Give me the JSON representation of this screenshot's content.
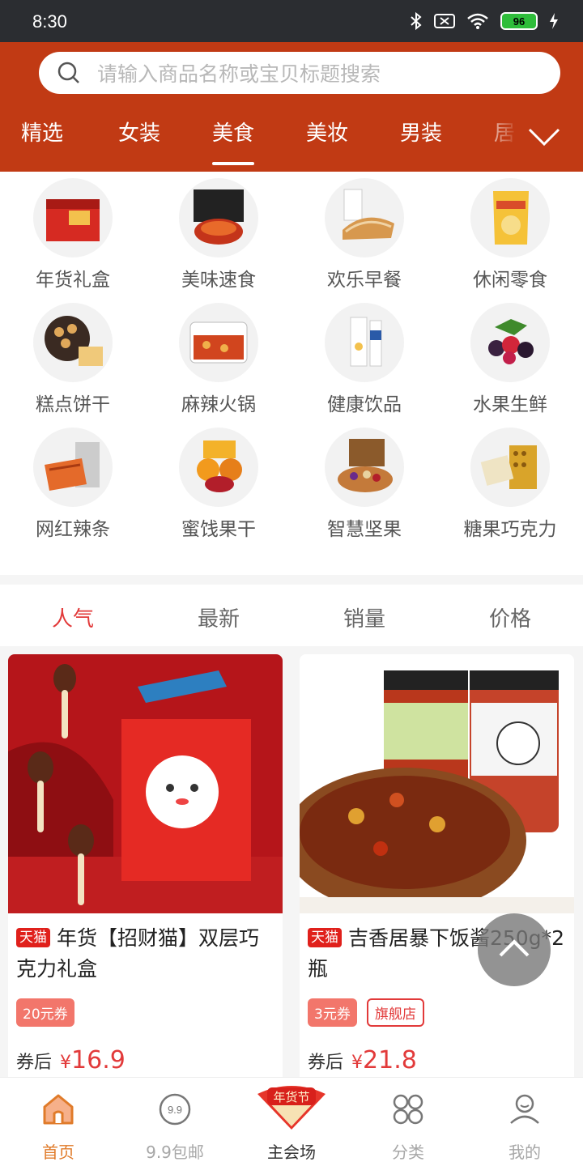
{
  "status_bar": {
    "time": "8:30",
    "battery": "96"
  },
  "search": {
    "placeholder": "请输入商品名称或宝贝标题搜索"
  },
  "tabs": [
    "精选",
    "女装",
    "美食",
    "美妆",
    "男装",
    "居"
  ],
  "active_tab": "美食",
  "categories": [
    {
      "label": "年货礼盒"
    },
    {
      "label": "美味速食"
    },
    {
      "label": "欢乐早餐"
    },
    {
      "label": "休闲零食"
    },
    {
      "label": "糕点饼干"
    },
    {
      "label": "麻辣火锅"
    },
    {
      "label": "健康饮品"
    },
    {
      "label": "水果生鲜"
    },
    {
      "label": "网红辣条"
    },
    {
      "label": "蜜饯果干"
    },
    {
      "label": "智慧坚果"
    },
    {
      "label": "糖果巧克力"
    }
  ],
  "sort_options": [
    "人气",
    "最新",
    "销量",
    "价格"
  ],
  "active_sort": "人气",
  "products": [
    {
      "platform": "天猫",
      "title": "年货【招财猫】双层巧克力礼盒",
      "coupon": "20元券",
      "badge": "",
      "price_prefix": "券后",
      "currency": "¥",
      "price": "16.9"
    },
    {
      "platform": "天猫",
      "title": "吉香居暴下饭酱250g*2瓶",
      "coupon": "3元券",
      "badge": "旗舰店",
      "price_prefix": "券后",
      "currency": "¥",
      "price": "21.8"
    }
  ],
  "bottom_nav": [
    {
      "label": "首页",
      "icon": "home-icon"
    },
    {
      "label": "9.9包邮",
      "icon": "nine-nine-icon"
    },
    {
      "label": "主会场",
      "icon": "festival-icon",
      "badge": "年货节"
    },
    {
      "label": "分类",
      "icon": "category-icon"
    },
    {
      "label": "我的",
      "icon": "user-icon"
    }
  ],
  "colors": {
    "header": "#c13a14",
    "accent_red": "#e23a3a",
    "nav_active": "#e07b2a"
  }
}
